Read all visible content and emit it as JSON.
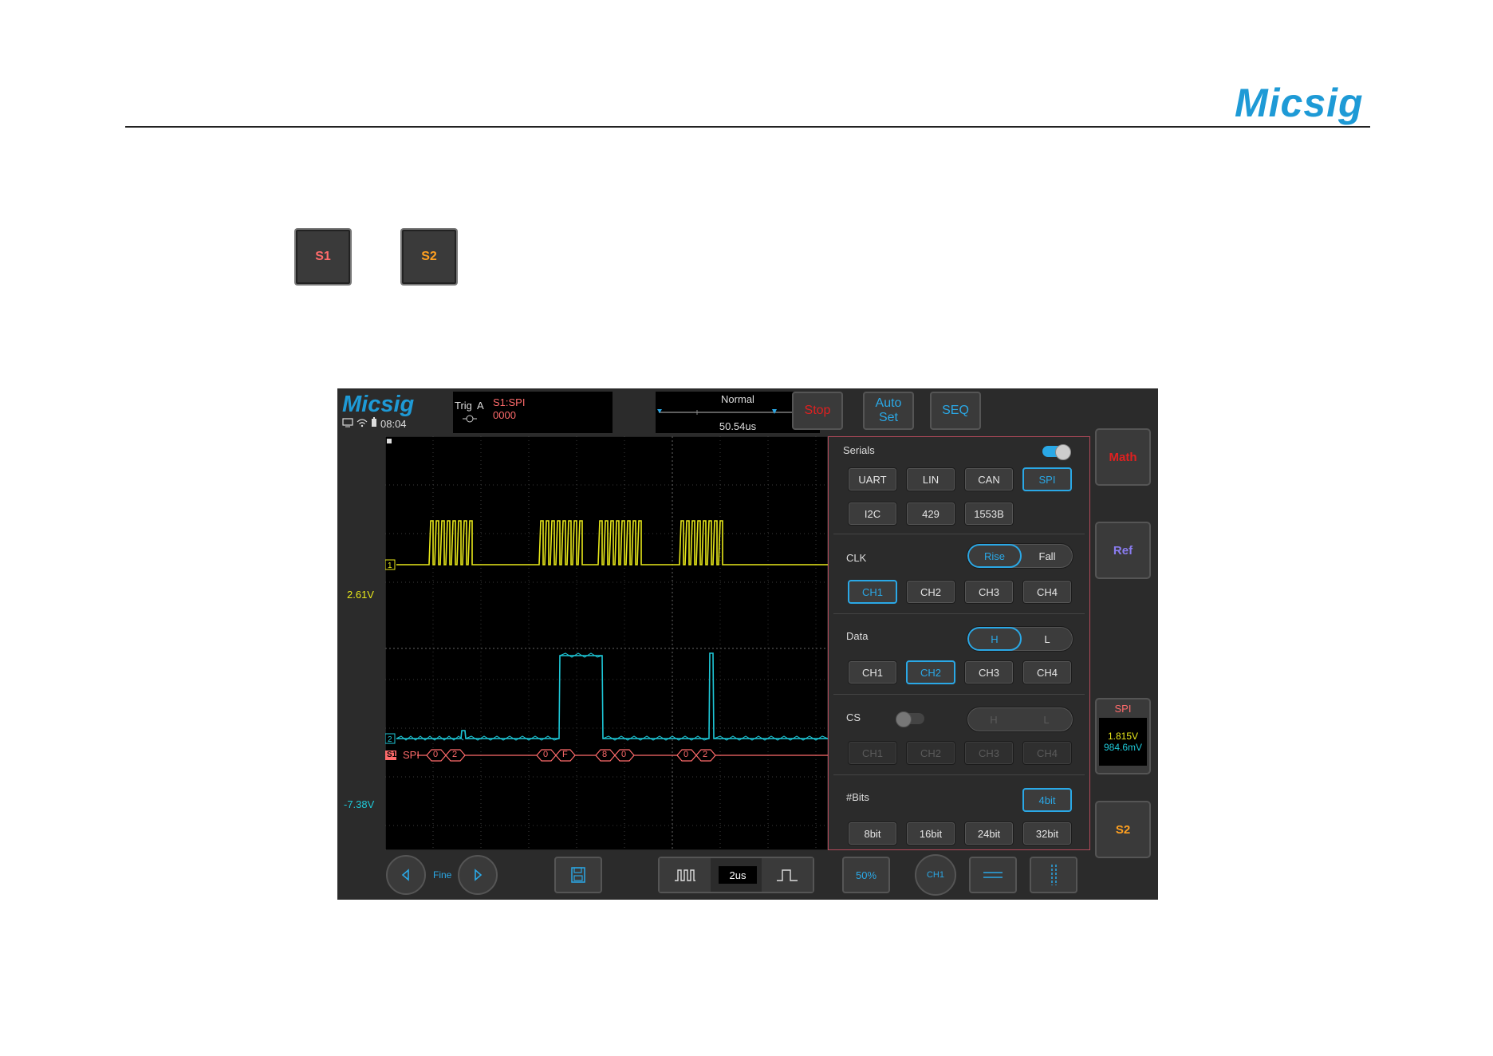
{
  "page": {
    "brand": "Micsig",
    "sample_buttons": [
      {
        "label": "S1",
        "color": "#ff6b6b"
      },
      {
        "label": "S2",
        "color": "#ffa020"
      }
    ]
  },
  "screen": {
    "logo": "Micsig",
    "status": {
      "time": "08:04",
      "icons": [
        "monitor-icon",
        "wifi-icon",
        "battery-icon"
      ]
    },
    "trigger": {
      "label": "Trig",
      "source": "A",
      "type": "S1:SPI",
      "value": "0000"
    },
    "timebase": {
      "mode": "Normal",
      "position": "50.54us"
    },
    "top_buttons": [
      {
        "label": "Stop",
        "color": "#e02020"
      },
      {
        "label": "Auto Set",
        "color": "#2aa8e6"
      },
      {
        "label": "SEQ",
        "color": "#2aa8e6"
      }
    ],
    "side_buttons": {
      "math": {
        "label": "Math",
        "color": "#e02020"
      },
      "ref": {
        "label": "Ref",
        "color": "#8a7cf0"
      },
      "spi": {
        "title": "SPI",
        "v1": "1.815V",
        "v2": "984.6mV"
      },
      "s2": {
        "label": "S2",
        "color": "#ffa020"
      }
    },
    "channels": {
      "ch1": {
        "marker": "1",
        "offset": "2.61V",
        "color": "#e8e81a"
      },
      "ch2": {
        "marker": "2",
        "offset": "-7.38V",
        "color": "#1ec8d8"
      }
    },
    "decode": {
      "marker": "S1",
      "label": "SPI",
      "frames": [
        [
          "0",
          "2"
        ],
        [
          "0",
          "F"
        ],
        [
          "8",
          "0"
        ],
        [
          "0",
          "2"
        ]
      ]
    },
    "panel": {
      "title": "Serials",
      "protocols_row1": [
        "UART",
        "LIN",
        "CAN",
        "SPI"
      ],
      "protocols_row2": [
        "I2C",
        "429",
        "1553B"
      ],
      "active_protocol": "SPI",
      "clk": {
        "label": "CLK",
        "edges": [
          "Rise",
          "Fall"
        ],
        "active_edge": "Rise",
        "channels": [
          "CH1",
          "CH2",
          "CH3",
          "CH4"
        ],
        "active_channel": "CH1"
      },
      "data": {
        "label": "Data",
        "levels": [
          "H",
          "L"
        ],
        "active_level": "H",
        "channels": [
          "CH1",
          "CH2",
          "CH3",
          "CH4"
        ],
        "active_channel": "CH2"
      },
      "cs": {
        "label": "CS",
        "enabled": false,
        "levels": [
          "H",
          "L"
        ],
        "channels": [
          "CH1",
          "CH2",
          "CH3",
          "CH4"
        ]
      },
      "bits": {
        "label": "#Bits",
        "current": "4bit",
        "options": [
          "8bit",
          "16bit",
          "24bit",
          "32bit"
        ]
      }
    },
    "bottom": {
      "fine_label": "Fine",
      "timebase_value": "2us",
      "percent": "50%",
      "level_btn": "CH1"
    }
  }
}
